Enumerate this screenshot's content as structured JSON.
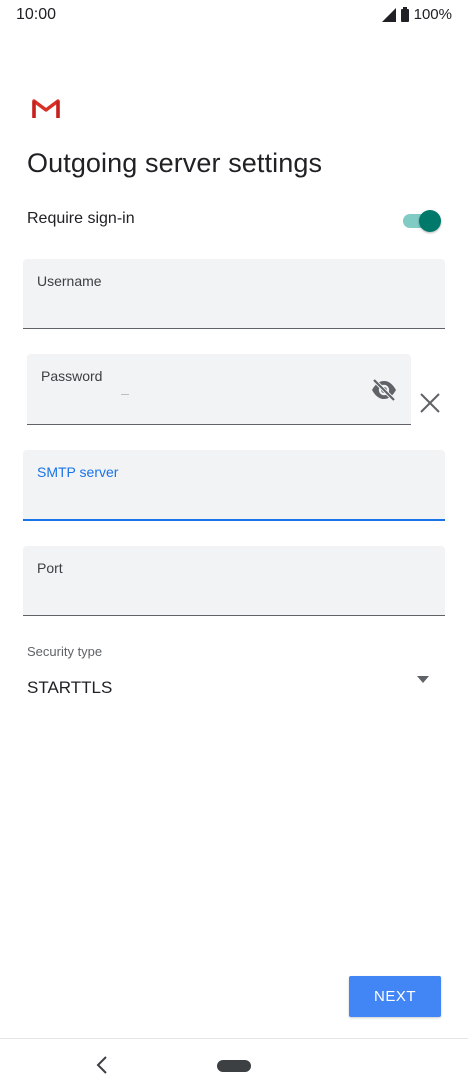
{
  "status_bar": {
    "time": "10:00",
    "battery": "100%",
    "icons": [
      "signal-icon",
      "battery-icon"
    ]
  },
  "app": {
    "logo": "gmail-logo",
    "title": "Outgoing server settings"
  },
  "require_signin": {
    "label": "Require sign-in",
    "enabled": true
  },
  "fields": {
    "username": {
      "label": "Username",
      "value": ""
    },
    "password": {
      "label": "Password",
      "value": ""
    },
    "smtp_server": {
      "label": "SMTP server",
      "value": "",
      "focused": true
    },
    "port": {
      "label": "Port",
      "value": ""
    }
  },
  "security": {
    "label": "Security type",
    "selected": "STARTTLS"
  },
  "actions": {
    "next_label": "NEXT"
  },
  "colors": {
    "accent": "#1a73e8",
    "toggle_on": "#00796b",
    "button": "#4285f4"
  }
}
